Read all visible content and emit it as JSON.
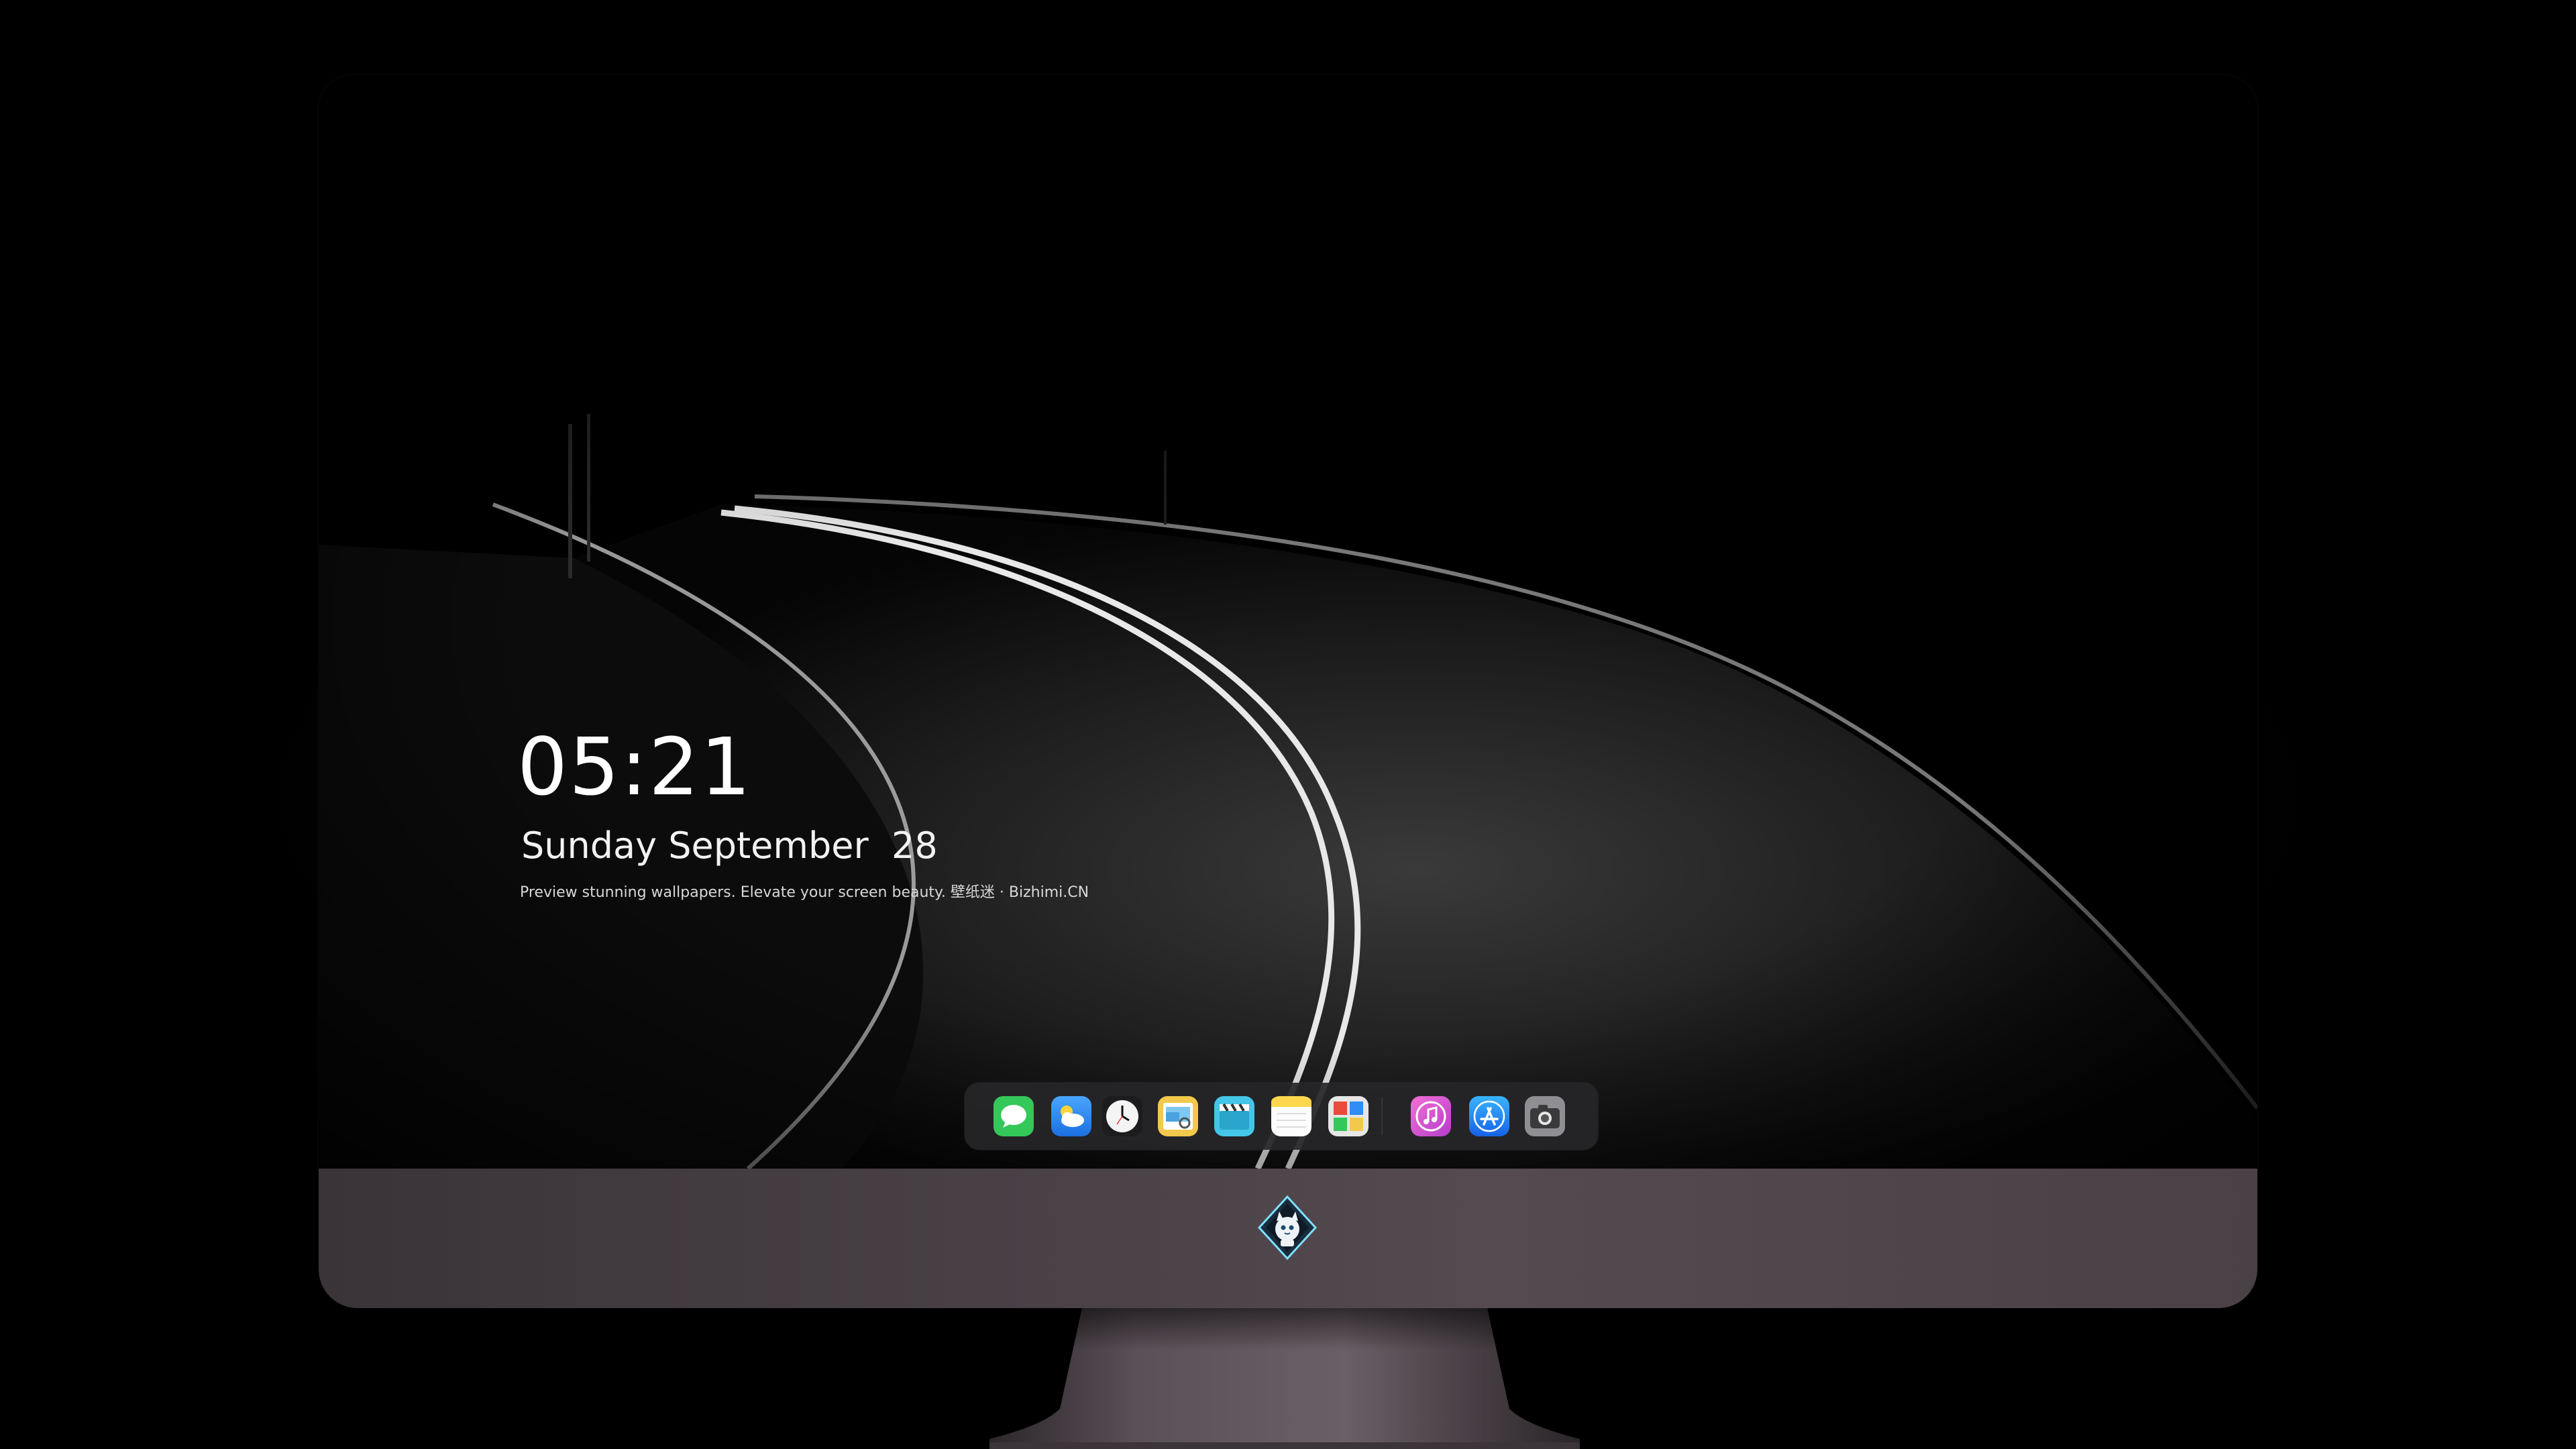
{
  "lockscreen": {
    "time": "05:21",
    "date": "Sunday September  28",
    "caption": "Preview stunning wallpapers. Elevate your screen beauty. 壁纸迷 · Bizhimi.CN"
  },
  "dock": {
    "apps": [
      {
        "name": "Messages",
        "icon": "messages-icon",
        "color": "#34c759"
      },
      {
        "name": "Weather",
        "icon": "weather-icon",
        "color": "#2f8df5"
      },
      {
        "name": "Clock",
        "icon": "clock-icon",
        "color": "#1c1c1e"
      },
      {
        "name": "Preview",
        "icon": "preview-icon",
        "color": "#f2c94c"
      },
      {
        "name": "Clips",
        "icon": "clapperboard-icon",
        "color": "#44c6e8"
      },
      {
        "name": "Notes",
        "icon": "notes-icon",
        "color": "#ffd84d"
      },
      {
        "name": "Photo Booth",
        "icon": "photo-grid-icon",
        "color": "#e94b3c"
      },
      {
        "name": "iTunes",
        "icon": "music-note-icon",
        "color": "#d94fd0"
      },
      {
        "name": "App Store",
        "icon": "app-store-icon",
        "color": "#1d8cf8"
      },
      {
        "name": "Camera",
        "icon": "camera-icon",
        "color": "#8e8e93"
      }
    ]
  },
  "monitor": {
    "logo": "mascot-logo-icon"
  }
}
